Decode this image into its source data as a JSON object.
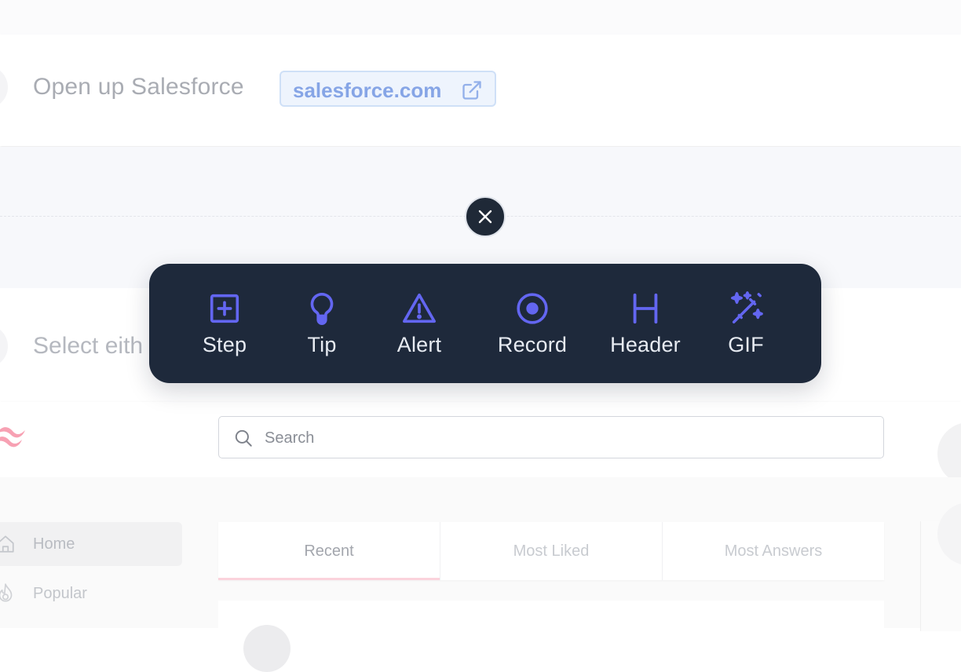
{
  "step1": {
    "title": "Open up Salesforce",
    "link_label": "salesforce.com",
    "link_icon": "external-link-icon"
  },
  "step2": {
    "title": "Select eith"
  },
  "close_icon": "close-icon",
  "toolbar": {
    "items": [
      {
        "label": "Step",
        "icon": "plus-square-icon"
      },
      {
        "label": "Tip",
        "icon": "lightbulb-icon"
      },
      {
        "label": "Alert",
        "icon": "warning-triangle-icon"
      },
      {
        "label": "Record",
        "icon": "record-icon"
      },
      {
        "label": "Header",
        "icon": "heading-icon"
      },
      {
        "label": "GIF",
        "icon": "magic-wand-icon"
      }
    ],
    "accent": "#6366f1",
    "background": "#1e293b"
  },
  "screenshot": {
    "search_placeholder": "Search",
    "sidebar": [
      {
        "label": "Home",
        "icon": "home-icon"
      },
      {
        "label": "Popular",
        "icon": "fire-icon"
      }
    ],
    "tabs": [
      "Recent",
      "Most Liked",
      "Most Answers"
    ]
  }
}
